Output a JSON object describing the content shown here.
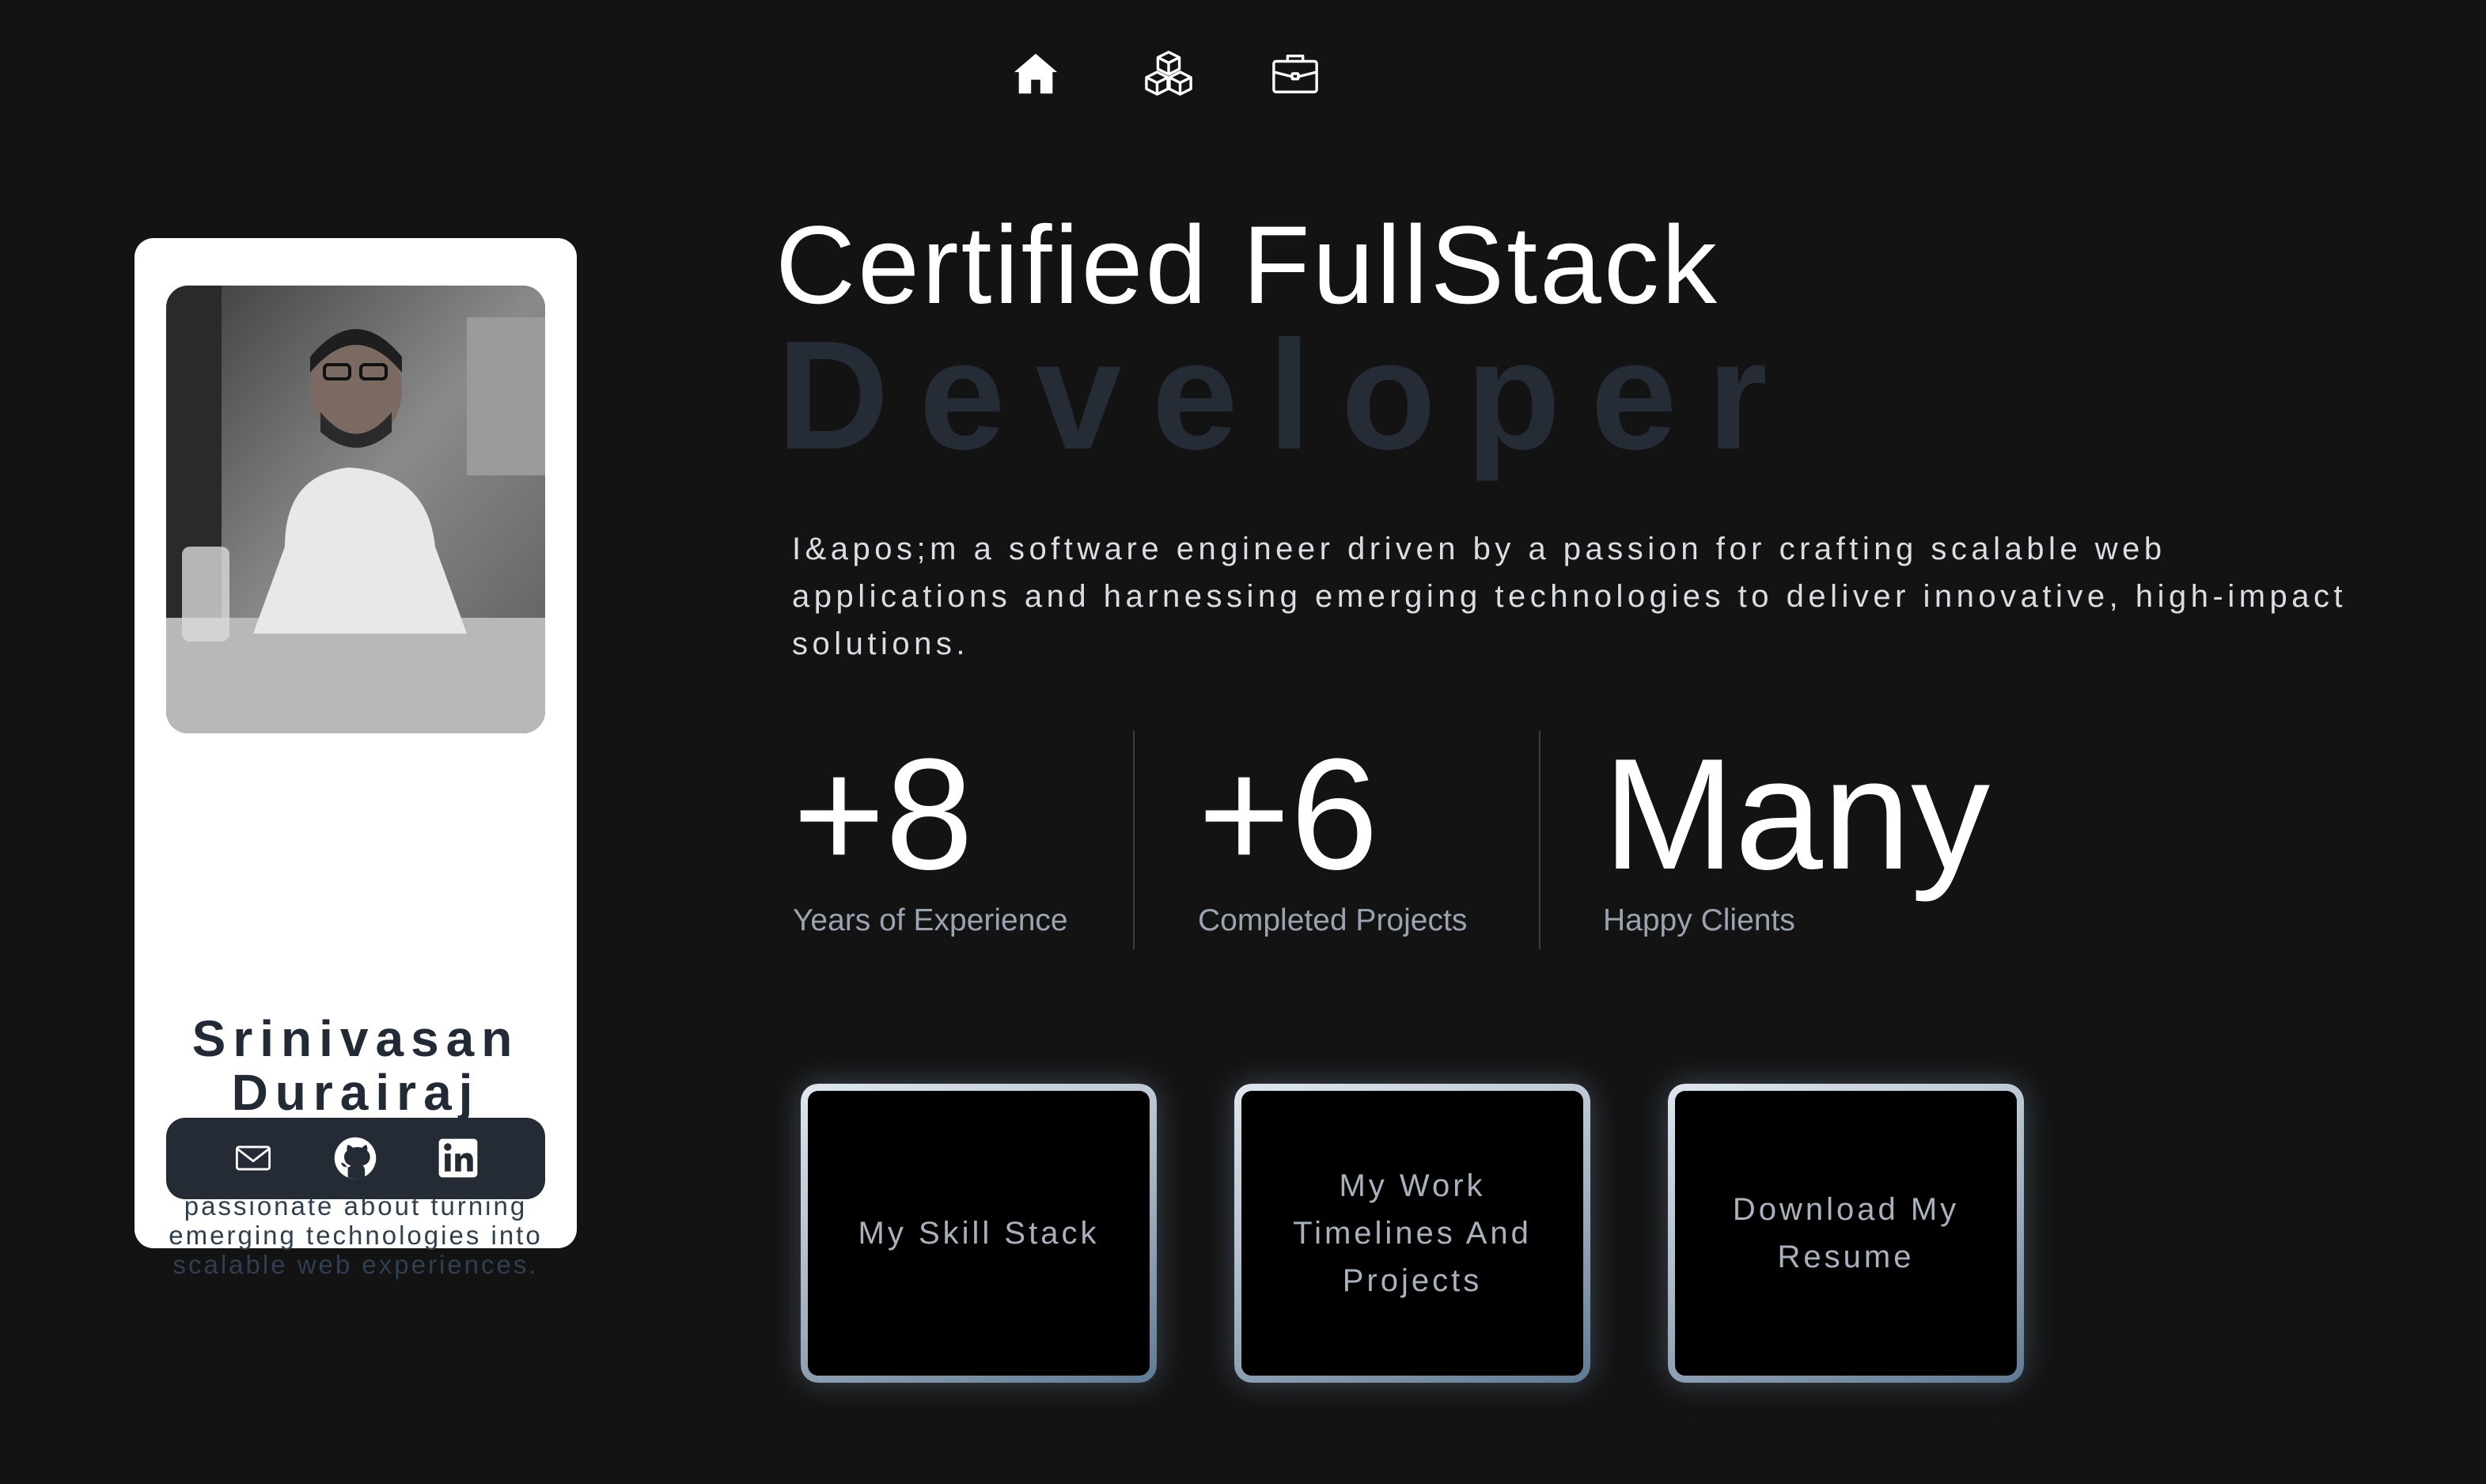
{
  "nav": {
    "items": [
      {
        "icon": "home-icon"
      },
      {
        "icon": "cubes-icon"
      },
      {
        "icon": "briefcase-icon"
      }
    ]
  },
  "profile": {
    "name_first": "Srinivasan",
    "name_last": "Durairaj",
    "bio": "A software engineer passionate about turning emerging technologies into scalable web experiences.",
    "social": [
      {
        "icon": "mail-icon"
      },
      {
        "icon": "github-icon"
      },
      {
        "icon": "linkedin-icon"
      }
    ]
  },
  "hero": {
    "title": "Certified FullStack",
    "subtitle": "Developer",
    "description": "I&apos;m a software engineer driven by a passion for crafting scalable web applications and harnessing emerging technologies to deliver innovative, high-impact solutions."
  },
  "stats": [
    {
      "value": "+8",
      "label": "Years of Experience"
    },
    {
      "value": "+6",
      "label": "Completed Projects"
    },
    {
      "value": "Many",
      "label": "Happy Clients"
    }
  ],
  "actions": [
    {
      "label": "My Skill Stack"
    },
    {
      "label": "My Work Timelines And Projects"
    },
    {
      "label": "Download My Resume"
    }
  ],
  "colors": {
    "background": "#131313",
    "card": "#ffffff",
    "subtitle": "#262c36",
    "social_bar": "#242b35"
  }
}
